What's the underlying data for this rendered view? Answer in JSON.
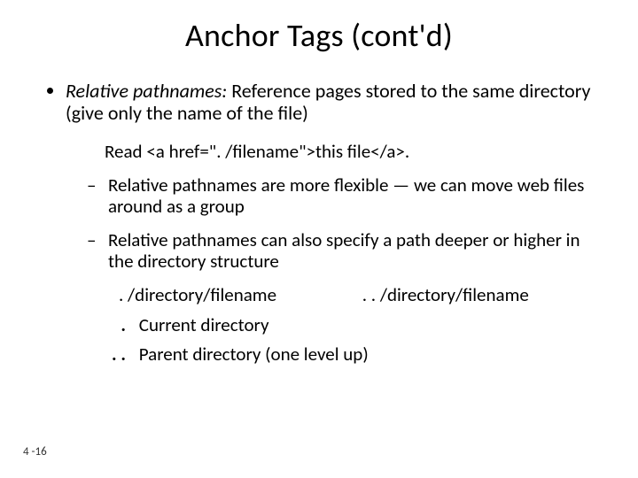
{
  "title": "Anchor Tags (cont'd)",
  "bullet": {
    "lead_italic": "Relative pathnames:",
    "lead_rest": " Reference pages stored to the same directory (give only the name of the file)"
  },
  "code_example": "Read <a href=\". /filename\">this file</a>.",
  "sub_bullets": [
    "Relative pathnames are more flexible — we can move web files around as a group",
    "Relative pathnames can also specify a path deeper or higher in the directory structure"
  ],
  "path_examples": {
    "current": ". /directory/filename",
    "parent": ". . /directory/filename"
  },
  "definitions": [
    {
      "symbol": ".",
      "meaning": "Current directory"
    },
    {
      "symbol": ". .",
      "meaning": "Parent directory (one level up)"
    }
  ],
  "page_number": "4 -16"
}
